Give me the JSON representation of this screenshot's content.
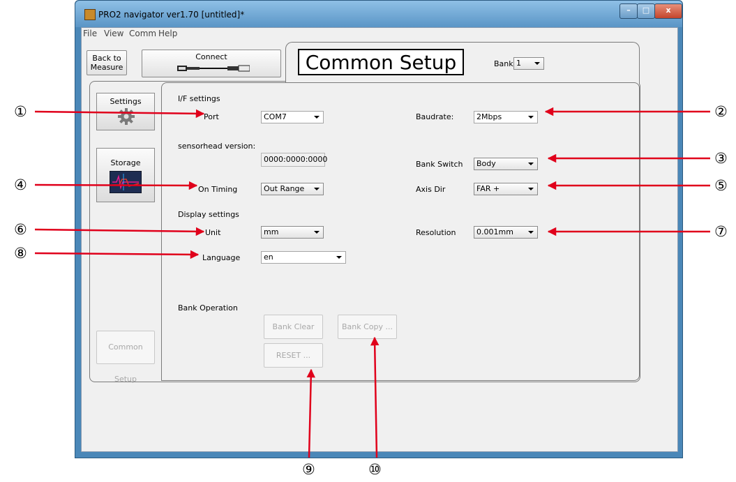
{
  "window": {
    "title": "PRO2 navigator ver1.70 [untitled]*",
    "min_glyph": "–",
    "max_glyph": "□",
    "close_glyph": "x"
  },
  "menu": [
    "File",
    "View",
    "Comm",
    "Help"
  ],
  "toolbar": {
    "back_line1": "Back to",
    "back_line2": "Measure",
    "connect_label": "Connect"
  },
  "header": {
    "title": "Common Setup",
    "bank_label": "Bank",
    "bank_value": "1"
  },
  "side": {
    "settings_label": "Settings",
    "storage_label": "Storage",
    "common_setup_label": "Common Setup"
  },
  "if_settings": {
    "section": "I/F settings",
    "port_label": "Port",
    "port_value": "COM7",
    "baudrate_label": "Baudrate:",
    "baudrate_value": "2Mbps",
    "sensorhead_label": "sensorhead version:",
    "sensorhead_value": "0000:0000:0000",
    "bank_switch_label": "Bank Switch",
    "bank_switch_value": "Body",
    "on_timing_label": "On Timing",
    "on_timing_value": "Out Range",
    "axis_dir_label": "Axis Dir",
    "axis_dir_value": "FAR +"
  },
  "display_settings": {
    "section": "Display settings",
    "unit_label": "Unit",
    "unit_value": "mm",
    "resolution_label": "Resolution",
    "resolution_value": "0.001mm",
    "language_label": "Language",
    "language_value": "en"
  },
  "bank_operation": {
    "section": "Bank Operation",
    "clear_label": "Bank Clear",
    "copy_label": "Bank Copy ...",
    "reset_label": "RESET ..."
  },
  "annotations": [
    "①",
    "②",
    "③",
    "④",
    "⑤",
    "⑥",
    "⑦",
    "⑧",
    "⑨",
    "⑩"
  ],
  "colors": {
    "arrow": "#e0001b",
    "title_bar": "#6fa6d6",
    "window_frame": "#4a87b8"
  }
}
